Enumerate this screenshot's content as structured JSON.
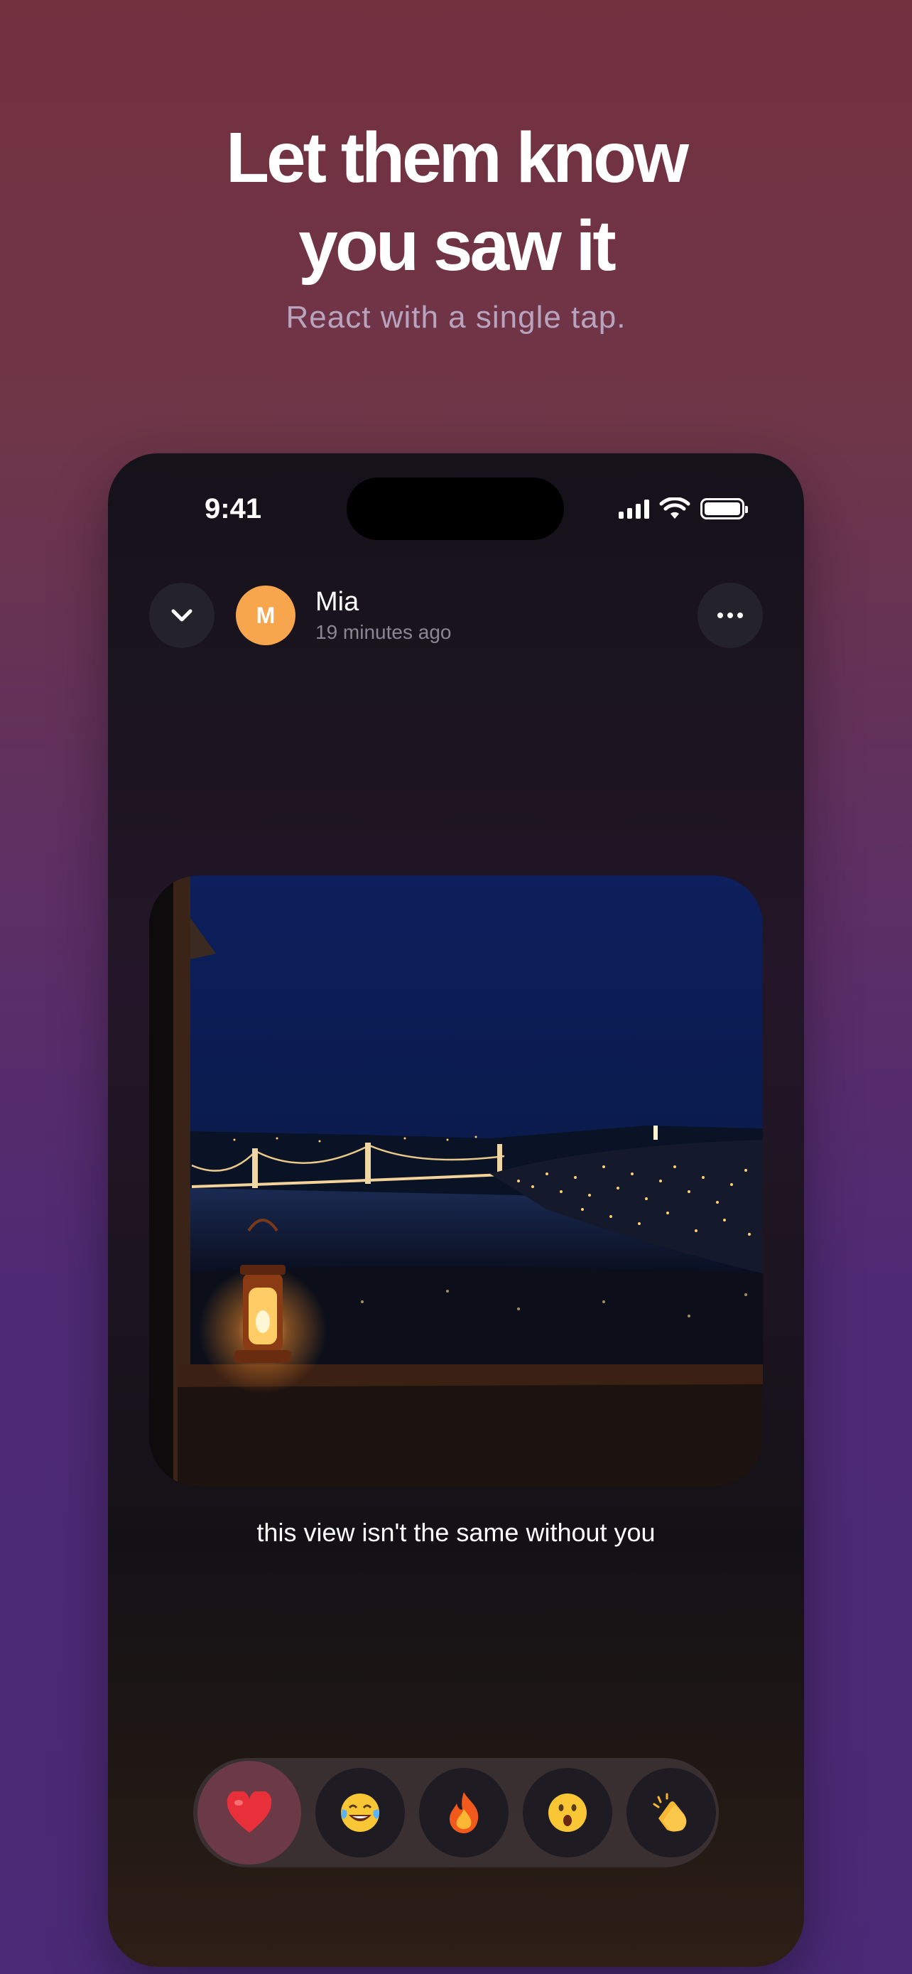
{
  "promo": {
    "headline_line1": "Let them know",
    "headline_line2": "you saw it",
    "subheadline": "React with a single tap."
  },
  "status_bar": {
    "time": "9:41",
    "icons": [
      "signal-icon",
      "wifi-icon",
      "battery-icon"
    ]
  },
  "header": {
    "collapse_icon": "chevron-down-icon",
    "avatar_initial": "M",
    "avatar_color": "#f8a64d",
    "user_name": "Mia",
    "posted_time": "19 minutes ago",
    "more_icon": "ellipsis-icon"
  },
  "post": {
    "photo_subject": "night city view with suspension bridge and lantern",
    "caption": "this view isn't the same without you"
  },
  "reactions": [
    {
      "name": "heart",
      "icon": "heart-emoji",
      "selected": true
    },
    {
      "name": "laughing",
      "icon": "tears-of-joy-emoji",
      "selected": false
    },
    {
      "name": "fire",
      "icon": "fire-emoji",
      "selected": false
    },
    {
      "name": "surprised",
      "icon": "surprised-face-emoji",
      "selected": false
    },
    {
      "name": "clapping",
      "icon": "clapping-hands-emoji",
      "selected": false
    }
  ],
  "colors": {
    "background_top": "#73303f",
    "background_bottom": "#4a2a76",
    "selected_reaction": "#6b3a46"
  }
}
